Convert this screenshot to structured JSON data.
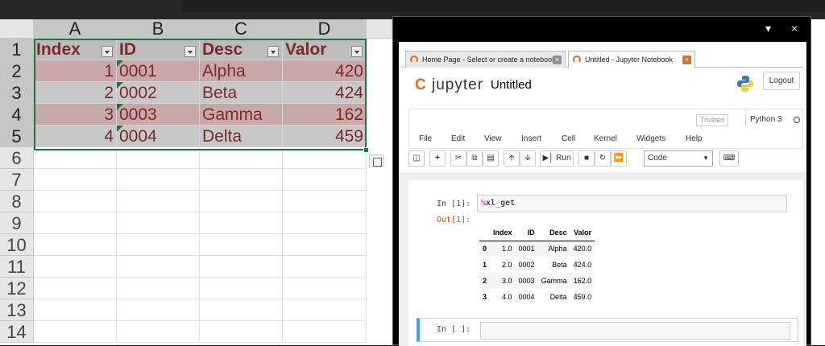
{
  "excel": {
    "columns": [
      "A",
      "B",
      "C",
      "D"
    ],
    "rows": [
      "1",
      "2",
      "3",
      "4",
      "5",
      "6",
      "7",
      "8",
      "9",
      "10",
      "11",
      "12",
      "13",
      "14"
    ],
    "header_cells": [
      "Index",
      "ID",
      "Desc",
      "Valor"
    ],
    "data_rows": [
      [
        "1",
        "0001",
        "Alpha",
        "420"
      ],
      [
        "2",
        "0002",
        "Beta",
        "424"
      ],
      [
        "3",
        "0003",
        "Gamma",
        "162"
      ],
      [
        "4",
        "0004",
        "Delta",
        "459"
      ]
    ],
    "colors": {
      "header_text": "#7b2a2a",
      "band_odd": "#c9a8a8",
      "band_even": "#c8c8c8",
      "selection": "#217346"
    }
  },
  "window": {
    "minimize_icon": "caret-down-icon",
    "close": "×"
  },
  "browser": {
    "tabs": [
      {
        "label": "Home Page - Select or create a notebook",
        "close": "×"
      },
      {
        "label": "Untitled - Jupyter Notebook",
        "close": "×"
      }
    ]
  },
  "jupyter": {
    "logo_text": "jupyter",
    "notebook_title": "Untitled",
    "logout_label": "Logout",
    "trusted_label": "Trusted",
    "kernel_label": "Python 3",
    "menu": [
      "File",
      "Edit",
      "View",
      "Insert",
      "Cell",
      "Kernel",
      "Widgets",
      "Help"
    ],
    "toolbar": {
      "run_label": "Run",
      "cell_type": "Code"
    },
    "cells": [
      {
        "in_prompt": "In [1]:",
        "source_magic": "%",
        "source_rest": "xl_get",
        "out_prompt": "Out[1]:"
      },
      {
        "in_prompt": "In [ ]:"
      }
    ],
    "dataframe": {
      "columns": [
        "Index",
        "ID",
        "Desc",
        "Valor"
      ],
      "rows": [
        [
          "0",
          "1.0",
          "0001",
          "Alpha",
          "420.0"
        ],
        [
          "1",
          "2.0",
          "0002",
          "Beta",
          "424.0"
        ],
        [
          "2",
          "3.0",
          "0003",
          "Gamma",
          "162.0"
        ],
        [
          "3",
          "4.0",
          "0004",
          "Delta",
          "459.0"
        ]
      ]
    }
  }
}
